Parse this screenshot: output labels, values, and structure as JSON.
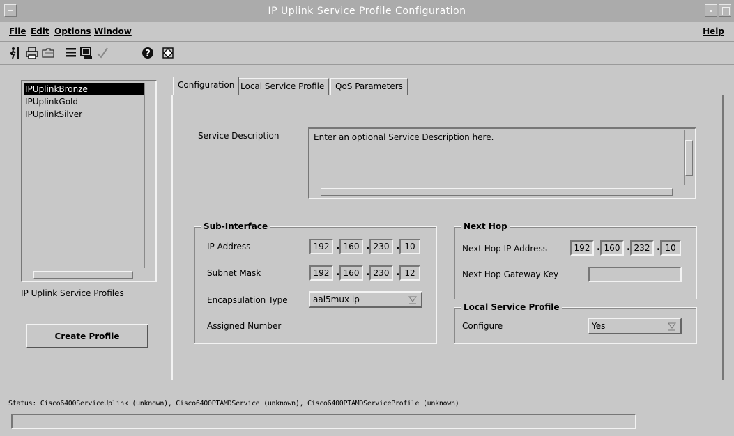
{
  "window": {
    "title": "IP Uplink Service Profile Configuration"
  },
  "menubar": {
    "file": "File",
    "edit": "Edit",
    "options": "Options",
    "window": "Window",
    "help": "Help"
  },
  "toolbar": {
    "icons": [
      "exit-icon",
      "print-icon",
      "open-folder-icon",
      "list-icon",
      "monitor-icon",
      "checkmark-icon",
      "help-icon",
      "refresh-icon"
    ]
  },
  "profiles": {
    "items": [
      "IPUplinkBronze",
      "IPUplinkGold",
      "IPUplinkSilver"
    ],
    "selected": "IPUplinkBronze",
    "caption": "IP Uplink Service Profiles",
    "create_button": "Create Profile"
  },
  "tabs": {
    "configuration": "Configuration",
    "local_service_profile": "Local Service Profile",
    "qos_parameters": "QoS Parameters",
    "active": "Configuration"
  },
  "form": {
    "service_description_label": "Service Description",
    "service_description_value": "Enter an optional Service Description here.",
    "sub_interface": {
      "title": "Sub-Interface",
      "ip_label": "IP Address",
      "ip": [
        "192",
        "160",
        "230",
        "10"
      ],
      "mask_label": "Subnet Mask",
      "mask": [
        "192",
        "160",
        "230",
        "12"
      ],
      "encap_label": "Encapsulation Type",
      "encap_value": "aal5mux ip",
      "assigned_label": "Assigned Number"
    },
    "next_hop": {
      "title": "Next Hop",
      "ip_label": "Next Hop IP Address",
      "ip": [
        "192",
        "160",
        "232",
        "10"
      ],
      "gateway_label": "Next Hop Gateway Key",
      "gateway_value": ""
    },
    "local_service_profile": {
      "title": "Local Service Profile",
      "configure_label": "Configure",
      "configure_value": "Yes"
    }
  },
  "status": {
    "text": "Status: Cisco6400ServiceUplink (unknown), Cisco6400PTAMDService (unknown), Cisco6400PTAMDServiceProfile (unknown)"
  },
  "colors": {
    "background": "#c8c8c8",
    "titlebar": "#ababab",
    "selection": "#000000"
  }
}
